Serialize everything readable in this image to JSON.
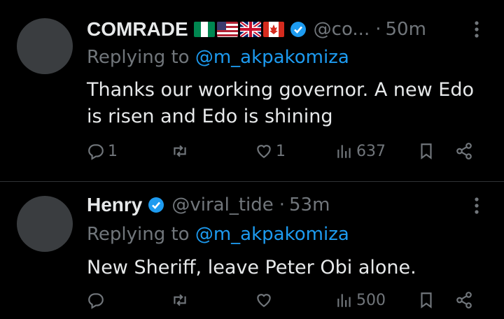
{
  "tweets": [
    {
      "name": "COMRADE",
      "flags": [
        "nigeria-flag",
        "usa-flag",
        "uk-flag",
        "canada-flag"
      ],
      "handle": "@co...",
      "separator": "·",
      "time": "50m",
      "replying_prefix": "Replying to ",
      "replying_to": "@m_akpakomiza",
      "text": "Thanks our working governor. A new Edo is risen and Edo is shining",
      "replies": "1",
      "reposts": "",
      "likes": "1",
      "views": "637"
    },
    {
      "name": "Henry",
      "handle": "@viral_tide",
      "separator": "·",
      "time": "53m",
      "replying_prefix": "Replying to ",
      "replying_to": "@m_akpakomiza",
      "text": "New Sheriff, leave Peter Obi alone.",
      "replies": "",
      "reposts": "",
      "likes": "",
      "views": "500"
    }
  ],
  "colors": {
    "background": "#000000",
    "text": "#e7e9ea",
    "muted": "#71767b",
    "accent": "#1d9bf0",
    "divider": "#2f3336"
  }
}
